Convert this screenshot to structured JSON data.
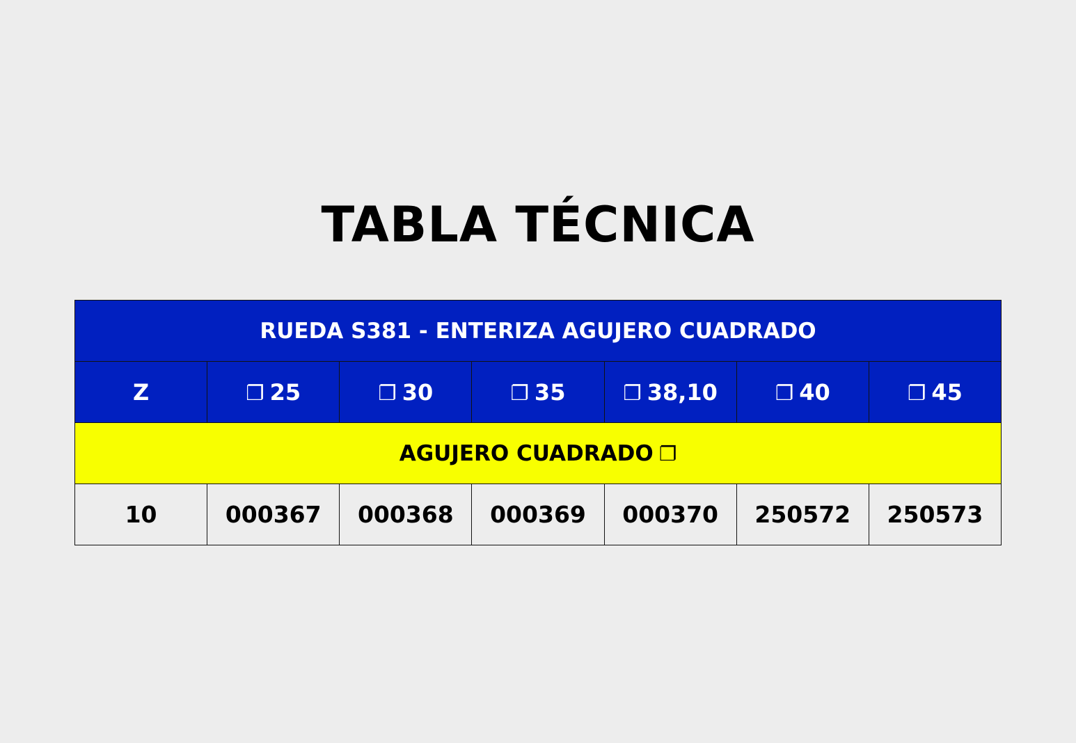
{
  "title": "TABLA TÉCNICA",
  "table": {
    "caption": "RUEDA S381 - ENTERIZA AGUJERO CUADRADO",
    "headers": [
      {
        "icon": "",
        "label": "Z"
      },
      {
        "icon": "❐",
        "label": "25"
      },
      {
        "icon": "❐",
        "label": "30"
      },
      {
        "icon": "❐",
        "label": "35"
      },
      {
        "icon": "❐",
        "label": "38,10"
      },
      {
        "icon": "❐",
        "label": "40"
      },
      {
        "icon": "❐",
        "label": "45"
      }
    ],
    "section": {
      "label": "AGUJERO CUADRADO",
      "icon": "❐"
    },
    "rows": [
      [
        "10",
        "000367",
        "000368",
        "000369",
        "000370",
        "250572",
        "250573"
      ]
    ]
  },
  "colors": {
    "header_blue": "#0120c0",
    "section_yellow": "#f8ff00",
    "background": "#ededed"
  }
}
